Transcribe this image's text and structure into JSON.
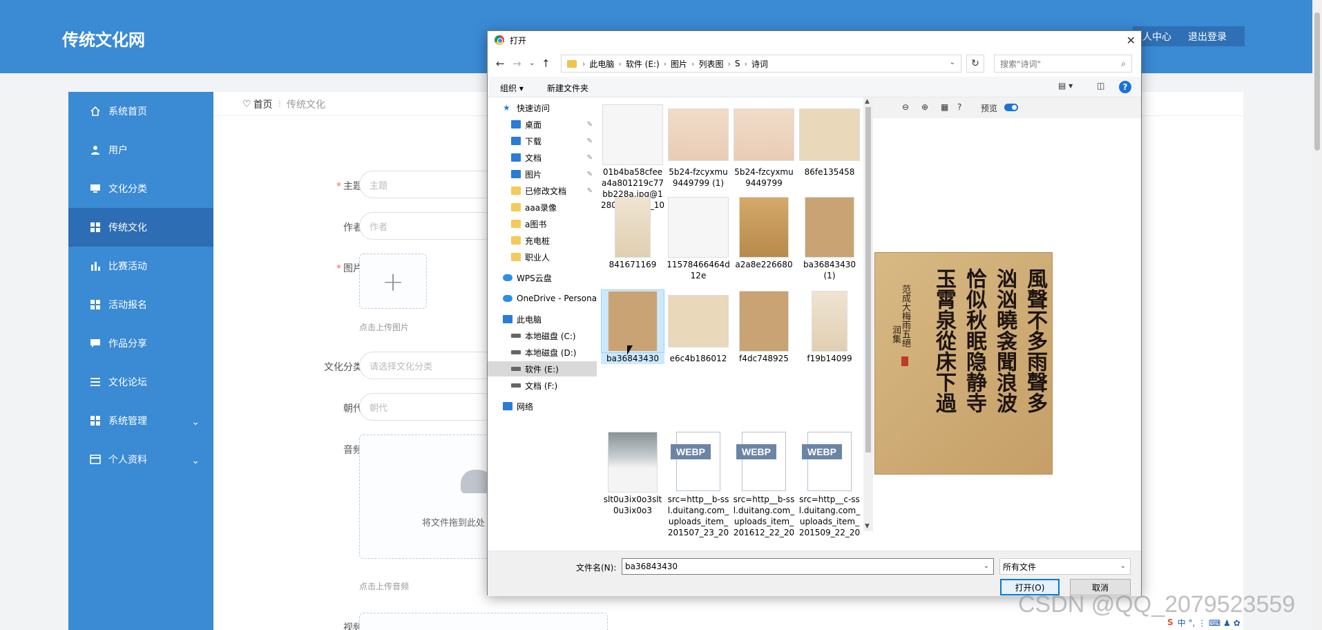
{
  "app": {
    "logo": "传统文化网",
    "personal_center": "人中心",
    "logout": "退出登录"
  },
  "sidebar": {
    "items": [
      {
        "label": "系统首页",
        "icon": "home-icon"
      },
      {
        "label": "用户",
        "icon": "user-icon"
      },
      {
        "label": "文化分类",
        "icon": "monitor-icon"
      },
      {
        "label": "传统文化",
        "icon": "grid-icon",
        "active": true
      },
      {
        "label": "比赛活动",
        "icon": "bar-chart-icon"
      },
      {
        "label": "活动报名",
        "icon": "grid-icon"
      },
      {
        "label": "作品分享",
        "icon": "chat-icon"
      },
      {
        "label": "文化论坛",
        "icon": "list-icon"
      },
      {
        "label": "系统管理",
        "icon": "grid-icon",
        "caret": "⌄"
      },
      {
        "label": "个人资料",
        "icon": "card-icon",
        "caret": "⌄"
      }
    ]
  },
  "breadcrumb": {
    "home": "首页",
    "sep": "⁝",
    "current": "传统文化"
  },
  "form": {
    "subject_label": "主题",
    "subject_placeholder": "主题",
    "author_label": "作者",
    "author_placeholder": "作者",
    "image_label": "图片",
    "image_hint": "点击上传图片",
    "category_label": "文化分类",
    "category_placeholder": "请选择文化分类",
    "dynasty_label": "朝代",
    "dynasty_placeholder": "朝代",
    "audio_label": "音频",
    "audio_drop_text": "将文件拖到此处",
    "audio_hint": "点击上传音频",
    "video_label": "视频"
  },
  "dialog": {
    "title": "打开",
    "path": [
      "此电脑",
      "软件 (E:)",
      "图片",
      "列表图",
      "S",
      "诗词"
    ],
    "search_placeholder": "搜索\"诗词\"",
    "organize": "组织 ▾",
    "new_folder": "新建文件夹",
    "tree": [
      {
        "label": "快速访问",
        "type": "star",
        "indent": 0
      },
      {
        "label": "桌面",
        "type": "blue",
        "indent": 1,
        "pinned": true
      },
      {
        "label": "下载",
        "type": "blue",
        "indent": 1,
        "pinned": true
      },
      {
        "label": "文档",
        "type": "blue",
        "indent": 1,
        "pinned": true
      },
      {
        "label": "图片",
        "type": "blue",
        "indent": 1,
        "pinned": true
      },
      {
        "label": "已修改文档",
        "type": "folder",
        "indent": 1,
        "pinned": true
      },
      {
        "label": "aaa录像",
        "type": "folder",
        "indent": 1
      },
      {
        "label": "a图书",
        "type": "folder",
        "indent": 1
      },
      {
        "label": "充电桩",
        "type": "folder",
        "indent": 1
      },
      {
        "label": "职业人",
        "type": "folder",
        "indent": 1
      },
      {
        "label": "WPS云盘",
        "type": "cloud",
        "indent": 0
      },
      {
        "label": "OneDrive - Persona",
        "type": "cloud",
        "indent": 0
      },
      {
        "label": "此电脑",
        "type": "blue",
        "indent": 0
      },
      {
        "label": "本地磁盘 (C:)",
        "type": "drive",
        "indent": 1
      },
      {
        "label": "本地磁盘 (D:)",
        "type": "drive",
        "indent": 1
      },
      {
        "label": "软件 (E:)",
        "type": "drive",
        "indent": 1,
        "selected": true
      },
      {
        "label": "文档 (F:)",
        "type": "drive",
        "indent": 1
      },
      {
        "label": "网络",
        "type": "blue",
        "indent": 0
      }
    ],
    "files": [
      {
        "name": "01b4ba58cfeea4a801219c77bb228a.jpg@1280w_1l_2o_100sh",
        "thumb": "th-white"
      },
      {
        "name": "5b24-fzcyxmu9449799 (1)",
        "thumb": "th-paper"
      },
      {
        "name": "5b24-fzcyxmu9449799",
        "thumb": "th-paper"
      },
      {
        "name": "86fe135458",
        "thumb": "th-beige"
      },
      {
        "name": "841671169",
        "thumb": "th-tall"
      },
      {
        "name": "11578466464d12e",
        "thumb": "th-white"
      },
      {
        "name": "a2a8e226680",
        "thumb": "th-gold"
      },
      {
        "name": "ba36843430 (1)",
        "thumb": "th-tan"
      },
      {
        "name": "ba36843430",
        "thumb": "th-tan",
        "selected": true
      },
      {
        "name": "e6c4b186012",
        "thumb": "th-beige"
      },
      {
        "name": "f4dc748925",
        "thumb": "th-tan"
      },
      {
        "name": "f19b14099",
        "thumb": "th-tall"
      },
      {
        "name": "slt0u3ix0o3slt0u3ix0o3",
        "thumb": "th-land"
      },
      {
        "name": "src=http__b-ssl.duitang.com_uploads_item_201507_23_2015...",
        "thumb": "webp"
      },
      {
        "name": "src=http__b-ssl.duitang.com_uploads_item_201612_22_2016...",
        "thumb": "webp"
      },
      {
        "name": "src=http__c-ssl.duitang.com_uploads_item_201509_22_2015...",
        "thumb": "webp"
      }
    ],
    "webp_label": "WEBP",
    "preview_label": "预览",
    "preview_columns": [
      "風聲不多雨聲多",
      "汹汹曉衾聞浪波",
      "恰似秋眠隐静寺",
      "玉霄泉從床下過"
    ],
    "preview_signature": "范成大梅雨五絕",
    "preview_signature2": "润集",
    "filename_label": "文件名(N):",
    "filename_value": "ba36843430",
    "filetype_value": "所有文件",
    "open_btn": "打开(O)",
    "cancel_btn": "取消"
  },
  "watermark": "CSDN @QQ_2079523559",
  "taskbar": "中 °, ⋮ ⌨ ♟ ✿"
}
